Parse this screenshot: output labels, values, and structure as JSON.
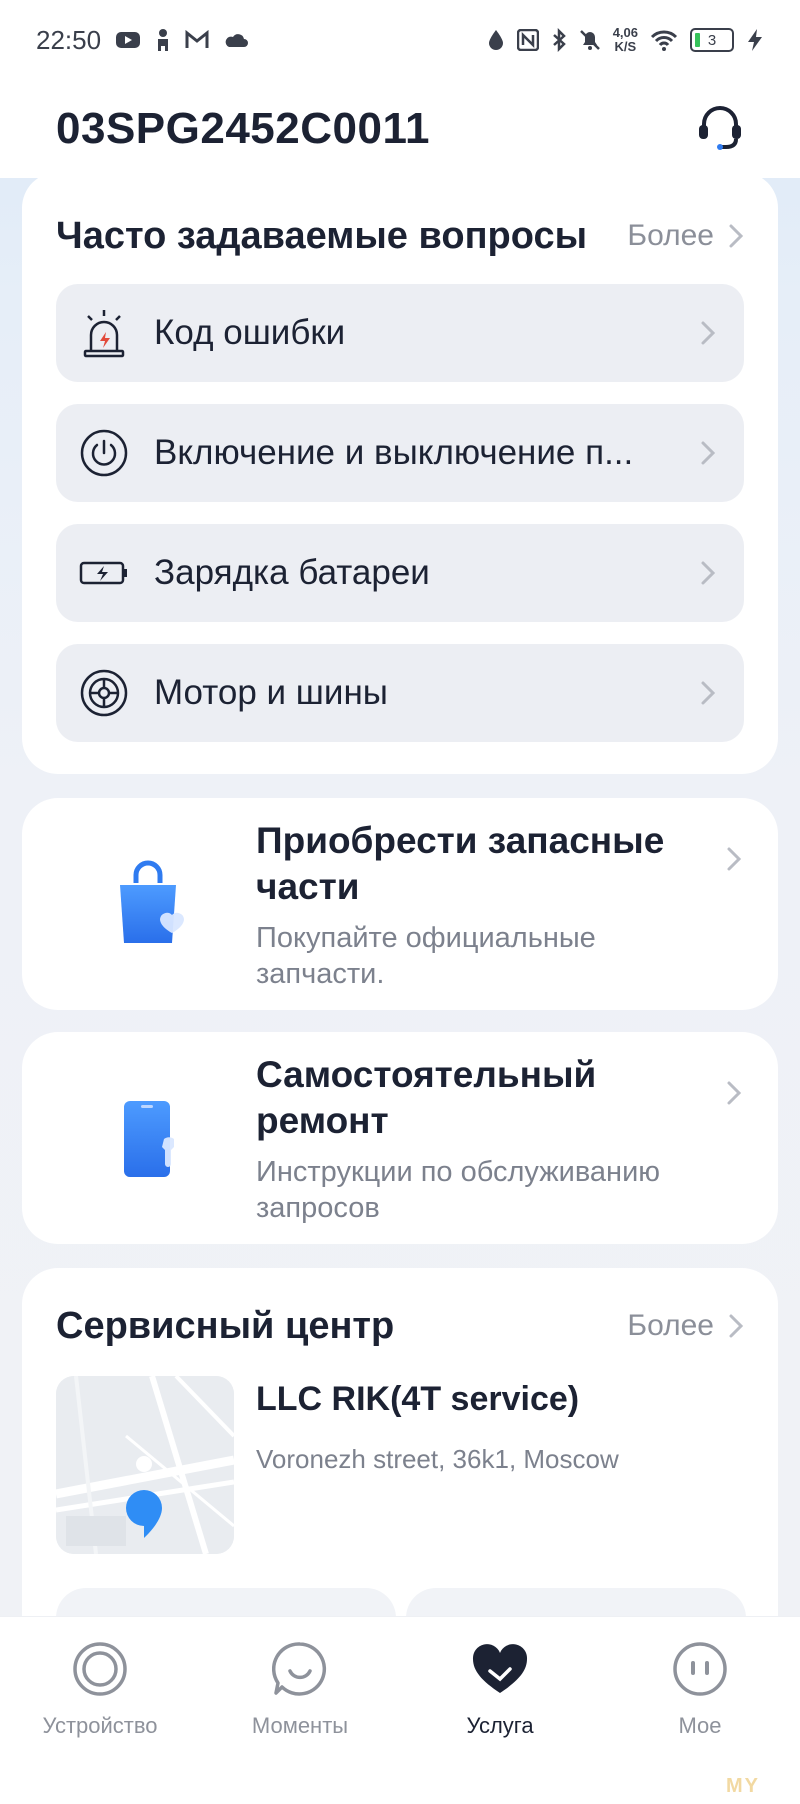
{
  "status_bar": {
    "time": "22:50",
    "left_icons": [
      "youtube-icon",
      "person-icon",
      "gmail-icon",
      "cloud-icon"
    ],
    "right_icons": [
      "data-saver-icon",
      "nfc-icon",
      "bluetooth-icon",
      "mute-icon",
      "wifi-icon",
      "charging-icon"
    ],
    "net_speed_value": "4,06",
    "net_speed_unit": "K/S",
    "battery_level": "3"
  },
  "header": {
    "title": "03SPG2452C0011",
    "support_icon": "headset-icon"
  },
  "faq": {
    "title": "Часто задаваемые вопросы",
    "more_label": "Более",
    "items": [
      {
        "label": "Код ошибки",
        "icon": "alarm-icon"
      },
      {
        "label": "Включение и выключение п...",
        "icon": "power-icon"
      },
      {
        "label": "Зарядка батареи",
        "icon": "battery-charging-icon"
      },
      {
        "label": "Мотор и шины",
        "icon": "wheel-icon"
      }
    ]
  },
  "promos": [
    {
      "title": "Приобрести запасные части",
      "subtitle": "Покупайте официальные запчасти.",
      "icon": "shopping-bag-icon"
    },
    {
      "title": "Самостоятельный ремонт",
      "subtitle": "Инструкции по обслуживанию запросов",
      "icon": "phone-wrench-icon"
    }
  ],
  "service_center": {
    "title": "Сервисный центр",
    "more_label": "Более",
    "name": "LLC RIK(4T service)",
    "address": "Voronezh street, 36k1, Moscow"
  },
  "tabs": [
    {
      "label": "Устройство",
      "icon": "device-ring-icon",
      "active": false
    },
    {
      "label": "Моменты",
      "icon": "chat-smile-icon",
      "active": false
    },
    {
      "label": "Услуга",
      "icon": "heart-icon",
      "active": true
    },
    {
      "label": "Мое",
      "icon": "profile-face-icon",
      "active": false
    }
  ],
  "colors": {
    "accent_blue": "#2f7bf0",
    "text_primary": "#1c2233",
    "text_secondary": "#7c818d",
    "item_background": "#eceef3",
    "alarm_red": "#e24a3b"
  },
  "watermark": "MY"
}
